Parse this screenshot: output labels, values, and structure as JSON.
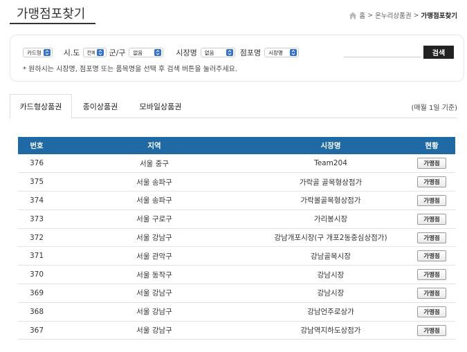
{
  "page": {
    "title": "가맹점포찾기"
  },
  "breadcrumb": {
    "home": "홈",
    "parent": "온누리상품권",
    "current": "가맹점포찾기",
    "separator": ">"
  },
  "search": {
    "card_type": "카드형",
    "sido_label": "시.도",
    "sido_value": "전체",
    "gungu_label": "군/구",
    "gungu_value": "없음",
    "market_label": "시장명",
    "market_value": "없음",
    "store_label": "점포명",
    "store_value": "시장명",
    "keyword_value": "",
    "button_label": "검색",
    "hint": "* 원하시는 시장명, 점포명 또는 품목명을 선택 후 검색 버튼을 눌러주세요."
  },
  "tabs": [
    {
      "label": "카드형상품권",
      "active": true
    },
    {
      "label": "종이상품권",
      "active": false
    },
    {
      "label": "모바일상품권",
      "active": false
    }
  ],
  "tab_note": "(매월 1일 기준)",
  "table": {
    "headers": [
      "번호",
      "지역",
      "시장명",
      "현황"
    ],
    "rows": [
      [
        "376",
        "서울 중구",
        "Team204",
        "가맹점"
      ],
      [
        "375",
        "서울 송파구",
        "가락골 골목형상점가",
        "가맹점"
      ],
      [
        "374",
        "서울 송파구",
        "가락몰골목형상점가",
        "가맹점"
      ],
      [
        "373",
        "서울 구로구",
        "가리봉시장",
        "가맹점"
      ],
      [
        "372",
        "서울 강남구",
        "강남개포시장(구 개포2동중심상점가)",
        "가맹점"
      ],
      [
        "371",
        "서울 관악구",
        "강남골목시장",
        "가맹점"
      ],
      [
        "370",
        "서울 동작구",
        "강남시장",
        "가맹점"
      ],
      [
        "369",
        "서울 강남구",
        "강남시장",
        "가맹점"
      ],
      [
        "368",
        "서울 강남구",
        "강남언주로상가",
        "가맹점"
      ],
      [
        "367",
        "서울 강남구",
        "강남역지하도상점가",
        "가맹점"
      ]
    ]
  },
  "colors": {
    "header_bg": "#1f6aa5",
    "select_arrow": "#2f6fd6",
    "search_button": "#222222"
  }
}
